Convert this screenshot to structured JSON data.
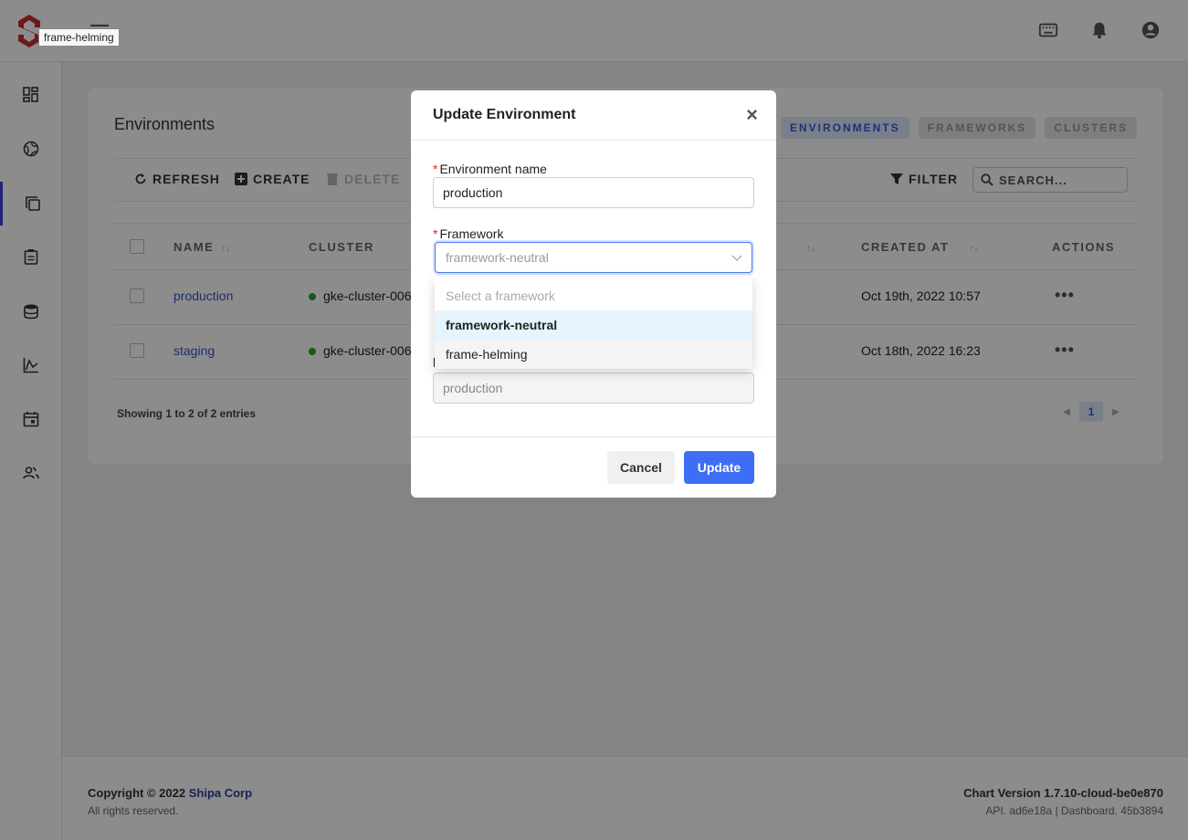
{
  "app": {
    "tooltip": "frame-helming",
    "brand_color": "#c92d2d",
    "accent_color": "#3d6ef5"
  },
  "topbar": {
    "icons": [
      "keyboard-icon",
      "bell-icon",
      "user-account-icon"
    ]
  },
  "sidebar": {
    "items": [
      {
        "icon": "dashboard-icon"
      },
      {
        "icon": "globe-icon"
      },
      {
        "icon": "environments-icon",
        "active": true
      },
      {
        "icon": "clipboard-icon"
      },
      {
        "icon": "database-icon"
      },
      {
        "icon": "chart-icon"
      },
      {
        "icon": "calendar-icon"
      },
      {
        "icon": "users-icon"
      }
    ]
  },
  "page": {
    "title": "Environments",
    "tabs": [
      {
        "label": "ENVIRONMENTS",
        "active": true
      },
      {
        "label": "FRAMEWORKS"
      },
      {
        "label": "CLUSTERS"
      }
    ],
    "toolbar": {
      "refresh": "REFRESH",
      "create": "CREATE",
      "delete": "DELETE",
      "filter": "FILTER",
      "search_placeholder": "SEARCH..."
    },
    "columns": {
      "name": "NAME",
      "cluster": "CLUSTER",
      "created_at": "CREATED AT",
      "actions": "ACTIONS"
    },
    "rows": [
      {
        "name": "production",
        "cluster": "gke-cluster-006",
        "created_at": "Oct 19th, 2022 10:57"
      },
      {
        "name": "staging",
        "cluster": "gke-cluster-006",
        "created_at": "Oct 18th, 2022 16:23"
      }
    ],
    "showing": "Showing 1 to 2 of 2 entries",
    "current_page": "1"
  },
  "footer": {
    "copyright_prefix": "Copyright © 2022 ",
    "company": "Shipa Corp",
    "rights": "All rights reserved.",
    "chart_version": "Chart Version 1.7.10-cloud-be0e870",
    "api_version": "API. ad6e18a | Dashboard. 45b3894"
  },
  "modal": {
    "title": "Update Environment",
    "env_name_label": "Environment name",
    "env_name_value": "production",
    "framework_label": "Framework",
    "framework_value": "framework-neutral",
    "dropdown": {
      "placeholder": "Select a framework",
      "options": [
        "framework-neutral",
        "frame-helming"
      ]
    },
    "hidden_field_value": "production",
    "cancel": "Cancel",
    "update": "Update"
  }
}
